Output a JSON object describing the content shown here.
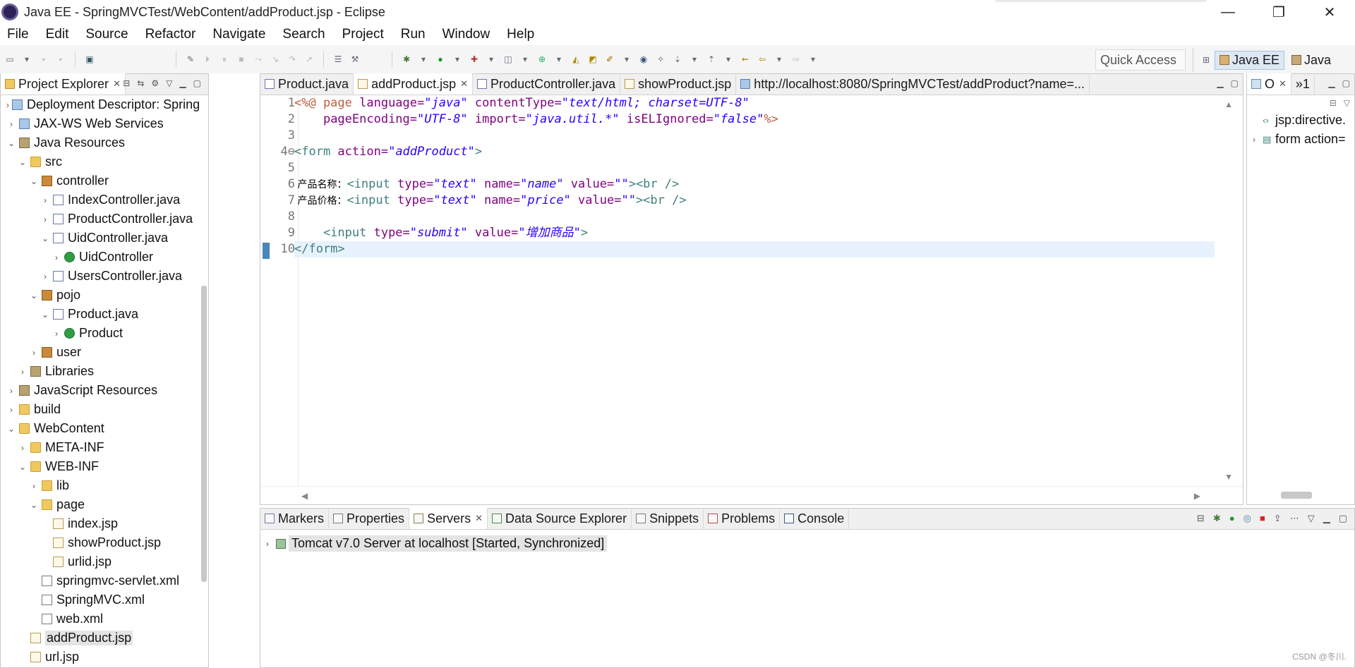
{
  "window": {
    "title": "Java EE - SpringMVCTest/WebContent/addProduct.jsp - Eclipse",
    "controls": [
      "—",
      "❐",
      "✕"
    ]
  },
  "menu": [
    "File",
    "Edit",
    "Source",
    "Refactor",
    "Navigate",
    "Search",
    "Project",
    "Run",
    "Window",
    "Help"
  ],
  "toolbar": {
    "quick_access": "Quick Access",
    "perspectives": [
      "Java EE",
      "Java"
    ]
  },
  "project_explorer": {
    "tab_label": "Project Explorer",
    "items": [
      {
        "label": "Deployment Descriptor: Spring",
        "depth": 1,
        "arrow": "›",
        "icon": "web"
      },
      {
        "label": "JAX-WS Web Services",
        "depth": 1,
        "arrow": "›",
        "icon": "web"
      },
      {
        "label": "Java Resources",
        "depth": 1,
        "arrow": "⌄",
        "icon": "lib"
      },
      {
        "label": "src",
        "depth": 2,
        "arrow": "⌄",
        "icon": "folder"
      },
      {
        "label": "controller",
        "depth": 3,
        "arrow": "⌄",
        "icon": "package"
      },
      {
        "label": "IndexController.java",
        "depth": 4,
        "arrow": "›",
        "icon": "java"
      },
      {
        "label": "ProductController.java",
        "depth": 4,
        "arrow": "›",
        "icon": "java"
      },
      {
        "label": "UidController.java",
        "depth": 4,
        "arrow": "⌄",
        "icon": "java"
      },
      {
        "label": "UidController",
        "depth": 5,
        "arrow": "›",
        "icon": "class"
      },
      {
        "label": "UsersController.java",
        "depth": 4,
        "arrow": "›",
        "icon": "java"
      },
      {
        "label": "pojo",
        "depth": 3,
        "arrow": "⌄",
        "icon": "package"
      },
      {
        "label": "Product.java",
        "depth": 4,
        "arrow": "⌄",
        "icon": "java"
      },
      {
        "label": "Product",
        "depth": 5,
        "arrow": "›",
        "icon": "class"
      },
      {
        "label": "user",
        "depth": 3,
        "arrow": "›",
        "icon": "package"
      },
      {
        "label": "Libraries",
        "depth": 2,
        "arrow": "›",
        "icon": "lib"
      },
      {
        "label": "JavaScript Resources",
        "depth": 1,
        "arrow": "›",
        "icon": "lib"
      },
      {
        "label": "build",
        "depth": 1,
        "arrow": "›",
        "icon": "folder"
      },
      {
        "label": "WebContent",
        "depth": 1,
        "arrow": "⌄",
        "icon": "folder"
      },
      {
        "label": "META-INF",
        "depth": 2,
        "arrow": "›",
        "icon": "folder"
      },
      {
        "label": "WEB-INF",
        "depth": 2,
        "arrow": "⌄",
        "icon": "folder"
      },
      {
        "label": "lib",
        "depth": 3,
        "arrow": "›",
        "icon": "folder"
      },
      {
        "label": "page",
        "depth": 3,
        "arrow": "⌄",
        "icon": "folder"
      },
      {
        "label": "index.jsp",
        "depth": 4,
        "arrow": "",
        "icon": "jsp"
      },
      {
        "label": "showProduct.jsp",
        "depth": 4,
        "arrow": "",
        "icon": "jsp"
      },
      {
        "label": "urlid.jsp",
        "depth": 4,
        "arrow": "",
        "icon": "jsp"
      },
      {
        "label": "springmvc-servlet.xml",
        "depth": 3,
        "arrow": "",
        "icon": "xml"
      },
      {
        "label": "SpringMVC.xml",
        "depth": 3,
        "arrow": "",
        "icon": "xml"
      },
      {
        "label": "web.xml",
        "depth": 3,
        "arrow": "",
        "icon": "xml"
      },
      {
        "label": "addProduct.jsp",
        "depth": 2,
        "arrow": "",
        "icon": "jsp",
        "selected": true
      },
      {
        "label": "url.jsp",
        "depth": 2,
        "arrow": "",
        "icon": "jsp"
      }
    ]
  },
  "editor": {
    "tabs": [
      {
        "label": "Product.java",
        "active": false,
        "closable": false
      },
      {
        "label": "addProduct.jsp",
        "active": true,
        "closable": true
      },
      {
        "label": "ProductController.java",
        "active": false,
        "closable": false
      },
      {
        "label": "showProduct.jsp",
        "active": false,
        "closable": false
      },
      {
        "label": "http://localhost:8080/SpringMVCTest/addProduct?name=...",
        "active": false,
        "closable": false
      }
    ],
    "line_numbers": [
      "1",
      "2",
      "3",
      "4⊖",
      "5",
      "6",
      "7",
      "8",
      "9",
      "10"
    ],
    "lines": [
      {
        "a": "<%@ page ",
        "b": "language=",
        "c": "\"java\" ",
        "d": "contentType=",
        "e": "\"text/html; charset=UTF-8\""
      },
      {
        "a": "    ",
        "b": "pageEncoding=",
        "c": "\"UTF-8\" ",
        "d": "import=",
        "e": "\"java.util.*\" ",
        "f": "isELIgnored=",
        "g": "\"false\"",
        "h": "%>"
      },
      {},
      {
        "a": "<form ",
        "b": "action=",
        "c": "\"addProduct\"",
        "h": ">"
      },
      {},
      {
        "t": " 产品名称：",
        "a": "<input ",
        "b": "type=",
        "c": "\"text\" ",
        "d": "name=",
        "e": "\"name\" ",
        "f": "value=",
        "g": "\"\"",
        "h": "><br />"
      },
      {
        "t": " 产品价格：",
        "a": "<input ",
        "b": "type=",
        "c": "\"text\" ",
        "d": "name=",
        "e": "\"price\" ",
        "f": "value=",
        "g": "\"\"",
        "h": "><br />"
      },
      {},
      {
        "a": "    <input ",
        "b": "type=",
        "c": "\"submit\" ",
        "d": "value=",
        "e": "\"增加商品\"",
        "h": ">"
      },
      {
        "a": "</form>"
      }
    ]
  },
  "outline": {
    "tabs": [
      "O",
      "»1"
    ],
    "items": [
      {
        "label": "jsp:directive.",
        "arrow": "",
        "icon": "‹›"
      },
      {
        "label": "form action=",
        "arrow": "›",
        "icon": "▤"
      }
    ]
  },
  "bottom_panel": {
    "tabs": [
      {
        "label": "Markers",
        "active": false
      },
      {
        "label": "Properties",
        "active": false
      },
      {
        "label": "Servers",
        "active": true
      },
      {
        "label": "Data Source Explorer",
        "active": false
      },
      {
        "label": "Snippets",
        "active": false
      },
      {
        "label": "Problems",
        "active": false
      },
      {
        "label": "Console",
        "active": false
      }
    ],
    "server": "Tomcat v7.0 Server at localhost  [Started, Synchronized]"
  },
  "watermark": "CSDN @冬川."
}
